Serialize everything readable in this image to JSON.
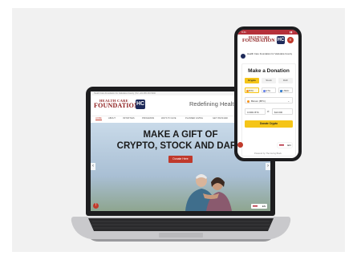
{
  "laptop": {
    "top_strip": "Health Care Foundation for Vadodara County  |  Tel: +91 265 233 5000",
    "logo": {
      "line1": "HEALTH CARE",
      "line2": "FOUNDATION",
      "mark": "HC"
    },
    "tagline": "Redefining Health C",
    "nav": [
      "HOME",
      "ABOUT",
      "INITIATIVES",
      "PROGRAMS",
      "WAYS TO GIVE",
      "PLANNED GIVING",
      "GET INVOLVED"
    ],
    "hero_line1": "MAKE A GIFT OF",
    "hero_line2": "CRYPTO, STOCK AND DAF'S",
    "donate_button": "Donate Here",
    "arrow_left": "‹",
    "arrow_right": "›",
    "language": "EN",
    "fab": "!"
  },
  "phone": {
    "status_time": "9:41",
    "status_right": "▮▮ ◔",
    "logo": {
      "line1": "HEALTH CARE",
      "line2": "FOUNDATION",
      "mark": "HC",
      "menu": "≡"
    },
    "org_name": "Health Care Foundation for Vadodara County",
    "title": "Make a Donation",
    "tabs": [
      "Crypto",
      "Stock",
      "DAF"
    ],
    "coins": [
      "BTC",
      "ETH",
      "USDC"
    ],
    "coin_select": "Bitcoin (BTC)",
    "coin_select_caret": "⌄",
    "amount_crypto": "0.0001 BTC",
    "amount_usd": "$10.000",
    "swap_icon": "⇄",
    "donate_button": "Donate Crypto",
    "language": "EN",
    "footer": "Powered by The Giving Block"
  },
  "colors": {
    "accent": "#c0392b",
    "brand_navy": "#1e2a5a",
    "highlight": "#f5c518"
  }
}
